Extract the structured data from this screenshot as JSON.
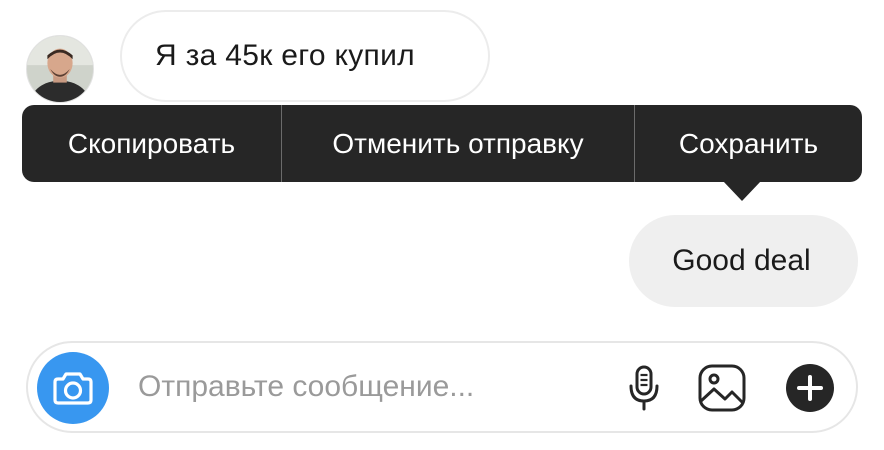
{
  "conversation": {
    "incoming_message": "Я за 45к его купил",
    "outgoing_message": "Good deal"
  },
  "context_menu": {
    "items": [
      {
        "label": "Скопировать"
      },
      {
        "label": "Отменить отправку"
      },
      {
        "label": "Сохранить"
      }
    ]
  },
  "composer": {
    "placeholder": "Отправьте сообщение..."
  },
  "icons": {
    "camera": "camera-icon",
    "microphone": "microphone-icon",
    "gallery": "gallery-icon",
    "plus": "plus-icon"
  },
  "colors": {
    "accent": "#3897f0",
    "menu_background": "#262626",
    "outgoing_bubble": "#efefef"
  }
}
